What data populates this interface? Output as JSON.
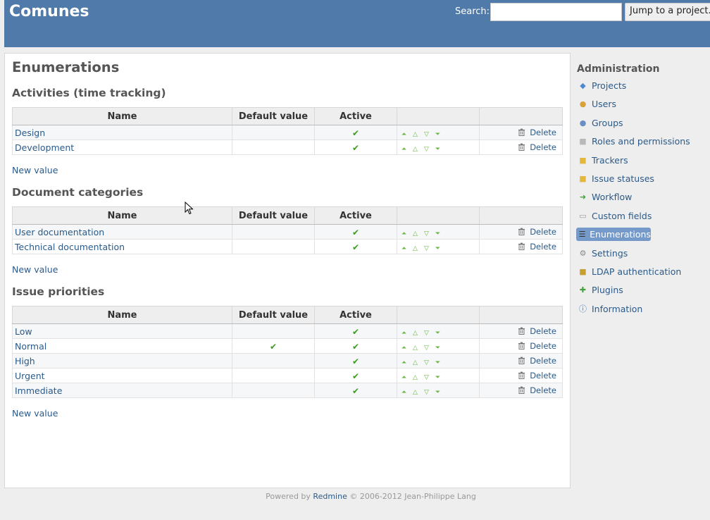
{
  "header": {
    "title": "Comunes",
    "search_label": "Search:",
    "search_value": "",
    "jump_label": "Jump to a project..."
  },
  "page_title": "Enumerations",
  "table_headers": {
    "name": "Name",
    "default_value": "Default value",
    "active": "Active"
  },
  "sections": [
    {
      "title": "Activities (time tracking)",
      "new_value_label": "New value",
      "rows": [
        {
          "name": "Design",
          "default": false,
          "active": true,
          "delete_label": "Delete"
        },
        {
          "name": "Development",
          "default": false,
          "active": true,
          "delete_label": "Delete"
        }
      ]
    },
    {
      "title": "Document categories",
      "new_value_label": "New value",
      "rows": [
        {
          "name": "User documentation",
          "default": false,
          "active": true,
          "delete_label": "Delete"
        },
        {
          "name": "Technical documentation",
          "default": false,
          "active": true,
          "delete_label": "Delete"
        }
      ]
    },
    {
      "title": "Issue priorities",
      "new_value_label": "New value",
      "rows": [
        {
          "name": "Low",
          "default": false,
          "active": true,
          "delete_label": "Delete"
        },
        {
          "name": "Normal",
          "default": true,
          "active": true,
          "delete_label": "Delete"
        },
        {
          "name": "High",
          "default": false,
          "active": true,
          "delete_label": "Delete"
        },
        {
          "name": "Urgent",
          "default": false,
          "active": true,
          "delete_label": "Delete"
        },
        {
          "name": "Immediate",
          "default": false,
          "active": true,
          "delete_label": "Delete"
        }
      ]
    }
  ],
  "sidebar": {
    "title": "Administration",
    "items": [
      {
        "label": "Projects",
        "icon": "projects-icon",
        "selected": false
      },
      {
        "label": "Users",
        "icon": "users-icon",
        "selected": false
      },
      {
        "label": "Groups",
        "icon": "groups-icon",
        "selected": false
      },
      {
        "label": "Roles and permissions",
        "icon": "roles-icon",
        "selected": false
      },
      {
        "label": "Trackers",
        "icon": "trackers-icon",
        "selected": false
      },
      {
        "label": "Issue statuses",
        "icon": "issue-statuses-icon",
        "selected": false
      },
      {
        "label": "Workflow",
        "icon": "workflow-icon",
        "selected": false
      },
      {
        "label": "Custom fields",
        "icon": "custom-fields-icon",
        "selected": false
      },
      {
        "label": "Enumerations",
        "icon": "enumerations-icon",
        "selected": true
      },
      {
        "label": "Settings",
        "icon": "settings-icon",
        "selected": false
      },
      {
        "label": "LDAP authentication",
        "icon": "ldap-icon",
        "selected": false
      },
      {
        "label": "Plugins",
        "icon": "plugins-icon",
        "selected": false
      },
      {
        "label": "Information",
        "icon": "information-icon",
        "selected": false
      }
    ]
  },
  "footer": {
    "prefix": "Powered by",
    "link": "Redmine",
    "suffix": "© 2006-2012 Jean-Philippe Lang"
  },
  "colors": {
    "header_bg": "#507aaa",
    "link": "#2a5a8a",
    "check": "#3c9a20",
    "selected_menu": "#759ac9"
  }
}
